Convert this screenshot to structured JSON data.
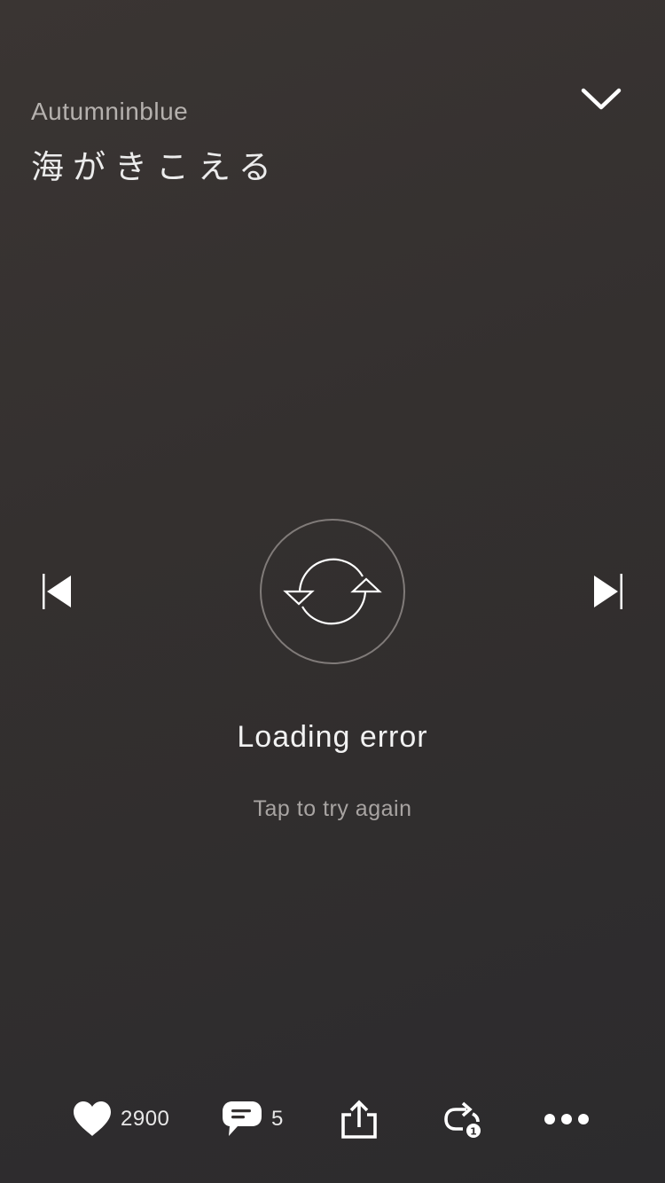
{
  "header": {
    "artist": "Autumninblue",
    "title": "海がきこえる",
    "collapse_icon": "chevron-down-icon"
  },
  "player": {
    "prev_icon": "skip-previous-icon",
    "next_icon": "skip-next-icon",
    "reload_icon": "reload-icon",
    "error_title": "Loading error",
    "error_hint": "Tap to try again"
  },
  "actions": {
    "like": {
      "icon": "heart-icon",
      "count": "2900"
    },
    "comment": {
      "icon": "comment-icon",
      "count": "5"
    },
    "share": {
      "icon": "share-icon"
    },
    "repost": {
      "icon": "repost-icon",
      "badge": "1"
    },
    "more": {
      "icon": "more-icon"
    }
  },
  "colors": {
    "background_top": "#3a3533",
    "background_bottom": "#2c2b2d",
    "foreground": "#ffffff",
    "muted_text": "#a8a4a2"
  }
}
